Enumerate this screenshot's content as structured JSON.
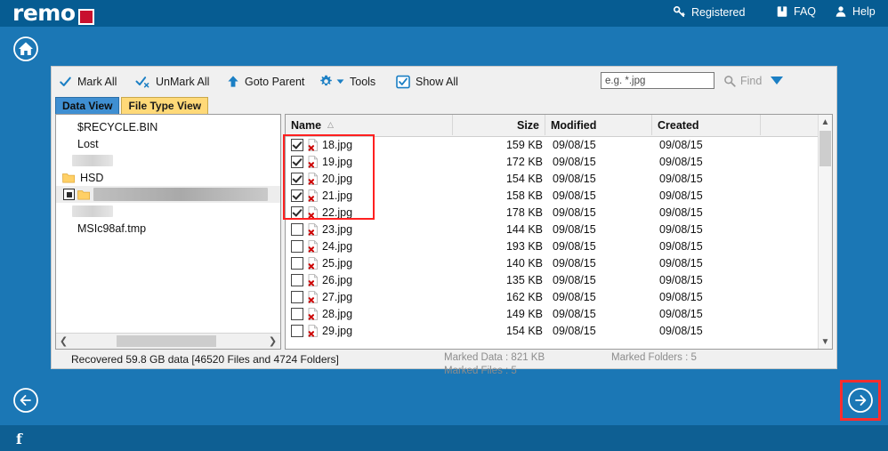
{
  "banner": {
    "logo_text": "remo",
    "nav": [
      {
        "icon": "key-icon",
        "label": "Registered"
      },
      {
        "icon": "book-icon",
        "label": "FAQ"
      },
      {
        "icon": "person-icon",
        "label": "Help"
      }
    ]
  },
  "nav_buttons": {
    "home": "home-icon",
    "back": "back-arrow-icon",
    "forward": "forward-arrow-icon",
    "facebook": "f"
  },
  "toolbar": {
    "mark_all": "Mark All",
    "unmark_all": "UnMark All",
    "goto_parent": "Goto Parent",
    "tools": "Tools",
    "show_all": "Show All",
    "search_placeholder": "e.g. *.jpg",
    "search_value": "",
    "find_label": "Find"
  },
  "tabs": [
    {
      "label": "Data View",
      "selected": true
    },
    {
      "label": "File Type View",
      "selected": false
    }
  ],
  "tree": {
    "items": [
      {
        "label": "$RECYCLE.BIN",
        "redacted": false,
        "selected": false,
        "expander": false
      },
      {
        "label": "Lost",
        "redacted": false,
        "selected": false,
        "expander": false
      },
      {
        "label": "",
        "redacted": true,
        "redact_width": 46,
        "selected": false,
        "expander": false
      },
      {
        "label": "HSD",
        "redacted": false,
        "selected": false,
        "expander": true
      },
      {
        "label": "",
        "redacted": true,
        "redact_width": 196,
        "redact_dark": true,
        "selected": true,
        "expander": true
      },
      {
        "label": "",
        "redacted": true,
        "redact_width": 46,
        "selected": false,
        "expander": false
      },
      {
        "label": "MSIc98af.tmp",
        "redacted": false,
        "selected": false,
        "expander": false
      }
    ]
  },
  "list": {
    "columns": [
      {
        "label": "Name",
        "sort": "ascending"
      },
      {
        "label": "Size"
      },
      {
        "label": "Modified"
      },
      {
        "label": "Created"
      },
      {
        "label": ""
      }
    ],
    "rows": [
      {
        "checked": true,
        "name": "18.jpg",
        "size": "159 KB",
        "modified": "09/08/15",
        "created": "09/08/15"
      },
      {
        "checked": true,
        "name": "19.jpg",
        "size": "172 KB",
        "modified": "09/08/15",
        "created": "09/08/15"
      },
      {
        "checked": true,
        "name": "20.jpg",
        "size": "154 KB",
        "modified": "09/08/15",
        "created": "09/08/15"
      },
      {
        "checked": true,
        "name": "21.jpg",
        "size": "158 KB",
        "modified": "09/08/15",
        "created": "09/08/15"
      },
      {
        "checked": true,
        "name": "22.jpg",
        "size": "178 KB",
        "modified": "09/08/15",
        "created": "09/08/15"
      },
      {
        "checked": false,
        "name": "23.jpg",
        "size": "144 KB",
        "modified": "09/08/15",
        "created": "09/08/15"
      },
      {
        "checked": false,
        "name": "24.jpg",
        "size": "193 KB",
        "modified": "09/08/15",
        "created": "09/08/15"
      },
      {
        "checked": false,
        "name": "25.jpg",
        "size": "140 KB",
        "modified": "09/08/15",
        "created": "09/08/15"
      },
      {
        "checked": false,
        "name": "26.jpg",
        "size": "135 KB",
        "modified": "09/08/15",
        "created": "09/08/15"
      },
      {
        "checked": false,
        "name": "27.jpg",
        "size": "162 KB",
        "modified": "09/08/15",
        "created": "09/08/15"
      },
      {
        "checked": false,
        "name": "28.jpg",
        "size": "149 KB",
        "modified": "09/08/15",
        "created": "09/08/15"
      },
      {
        "checked": false,
        "name": "29.jpg",
        "size": "154 KB",
        "modified": "09/08/15",
        "created": "09/08/15"
      }
    ]
  },
  "status": {
    "recovered": "Recovered 59.8 GB data [46520 Files and 4724 Folders]",
    "marked_data": "Marked Data : 821 KB",
    "marked_files": "Marked Files : 5",
    "marked_folders": "Marked Folders : 5"
  },
  "colors": {
    "banner": "#065c92",
    "body": "#1b77b5",
    "footer": "#0e5f93",
    "accent_red": "#c8102e",
    "highlight_red": "#ff2020",
    "tab_selected": "#3f8fd2",
    "tab_alt": "#ffd978"
  }
}
